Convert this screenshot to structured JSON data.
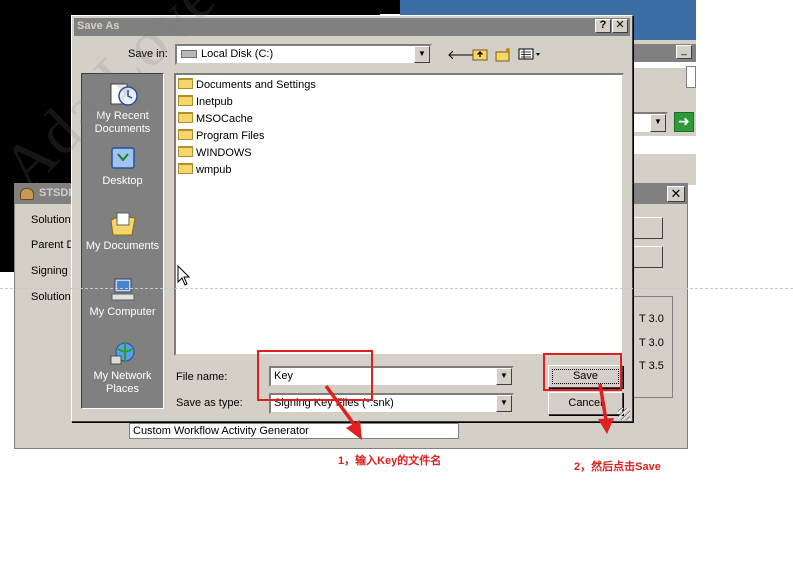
{
  "dialog": {
    "title": "Save As",
    "help_label": "?",
    "close_label": "✕",
    "save_in_label": "Save in:",
    "save_in_value": "Local Disk (C:)",
    "file_name_label": "File name:",
    "file_name_value": "Key",
    "save_as_type_label": "Save as type:",
    "save_as_type_value": "Signing Key Files (*.snk)",
    "save_button": "Save",
    "cancel_button": "Cancel"
  },
  "places": [
    {
      "label": "My Recent Documents",
      "icon": "recent-documents-icon"
    },
    {
      "label": "Desktop",
      "icon": "desktop-icon"
    },
    {
      "label": "My Documents",
      "icon": "my-documents-icon"
    },
    {
      "label": "My Computer",
      "icon": "my-computer-icon"
    },
    {
      "label": "My Network Places",
      "icon": "network-places-icon"
    }
  ],
  "files": [
    "Documents and Settings",
    "Inetpub",
    "MSOCache",
    "Program Files",
    "WINDOWS",
    "wmpub"
  ],
  "background_window": {
    "title": "STSDI",
    "labels": [
      "Solution",
      "Parent D",
      "Signing",
      "Solution"
    ],
    "versions": [
      "T 3.0",
      "T 3.0",
      "T 3.5"
    ],
    "text_field": "Custom Workflow Activity Generator"
  },
  "annotations": {
    "step1": "1，输入Key的文件名",
    "step2": "2，然后点击Save"
  },
  "watermark": "Ada Lovelace R",
  "colors": {
    "annotation_red": "#e02020",
    "dialog_face": "#d4d0c8",
    "inactive_title": "#808080",
    "places_bar": "#808080"
  }
}
